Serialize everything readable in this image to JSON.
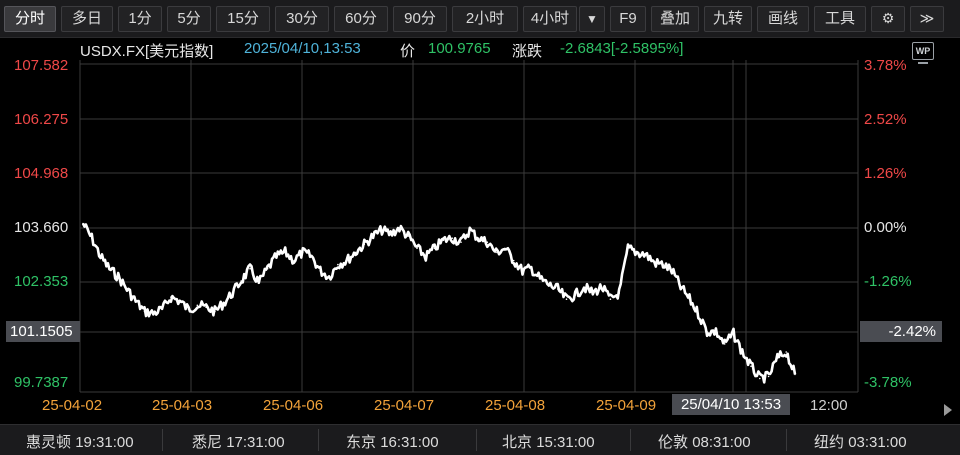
{
  "toolbar": {
    "tabs": [
      "分时",
      "多日",
      "1分",
      "5分",
      "15分",
      "30分",
      "60分",
      "90分",
      "2小时",
      "4小时",
      "▼",
      "F9",
      "叠加",
      "九转",
      "画线",
      "工具",
      "⚙",
      "≫"
    ],
    "active_tab": "分时"
  },
  "info": {
    "symbol": "USDX.FX[美元指数]",
    "datetime": "2025/04/10,13:53",
    "price_label": "价",
    "price": "100.9765",
    "change_label": "涨跌",
    "change": "-2.6843[-2.5895%]",
    "icon": "wp-icon",
    "icon_text": "WP"
  },
  "axes": {
    "left_ticks": [
      "107.582",
      "106.275",
      "104.968",
      "103.660",
      "102.353",
      "101.1505",
      "99.7387"
    ],
    "right_ticks": [
      "3.78%",
      "2.52%",
      "1.26%",
      "0.00%",
      "-1.26%",
      "-2.42%",
      "-3.78%"
    ],
    "x_ticks": [
      "25-04-02",
      "25-04-03",
      "25-04-06",
      "25-04-07",
      "25-04-08",
      "25-04-09",
      "25/04/10 13:53",
      "12:00"
    ]
  },
  "clocks": [
    {
      "city": "惠灵顿",
      "time": "19:31:00"
    },
    {
      "city": "悉尼",
      "time": "17:31:00"
    },
    {
      "city": "东京",
      "time": "16:31:00"
    },
    {
      "city": "北京",
      "time": "15:31:00"
    },
    {
      "city": "伦敦",
      "time": "08:31:00"
    },
    {
      "city": "纽约",
      "time": "03:31:00"
    }
  ],
  "colors": {
    "up": "#f04848",
    "down": "#2fc266",
    "line": "#ffffff",
    "grid": "#3a3a3a",
    "date": "#f3a33a",
    "price": "#2fc266",
    "datetime": "#4fb3d9"
  },
  "chart_data": {
    "type": "line",
    "ylim": [
      99.7387,
      107.582
    ],
    "prev_close": 103.66,
    "last": 100.9765,
    "series": [
      {
        "values": [
          103.66,
          103.3,
          102.85,
          102.55,
          102.35,
          102.05,
          101.75,
          101.5,
          101.45,
          101.55,
          101.85,
          101.75,
          101.55,
          101.65,
          101.6,
          101.5,
          101.7,
          101.95,
          102.25,
          102.55,
          102.2,
          102.55,
          102.85,
          102.95,
          102.75,
          102.95,
          102.85,
          102.5,
          102.35,
          102.65,
          102.75,
          102.95,
          103.15,
          103.35,
          103.5,
          103.4,
          103.55,
          103.35,
          103.05,
          102.85,
          103.05,
          103.25,
          103.3,
          103.2,
          103.5,
          103.3,
          103.2,
          102.95,
          103.05,
          102.75,
          102.5,
          102.55,
          102.3,
          102.15,
          102.05,
          101.8,
          101.9,
          102.1,
          101.95,
          102.1,
          101.8,
          101.95,
          103.05,
          102.95,
          102.9,
          102.7,
          102.65,
          102.5,
          102.1,
          101.8,
          101.45,
          101.0,
          101.0,
          100.7,
          100.95,
          100.5,
          100.15,
          99.85,
          99.9,
          100.35,
          100.5,
          99.95
        ]
      }
    ]
  }
}
